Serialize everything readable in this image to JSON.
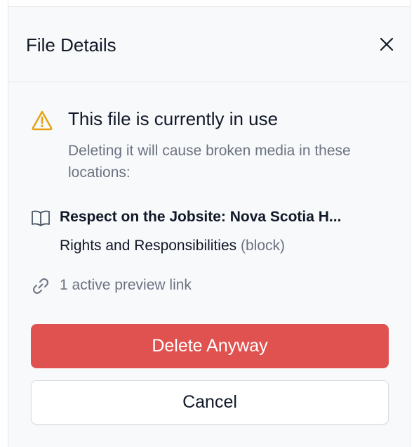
{
  "panel": {
    "title": "File Details",
    "close_icon": "close-icon"
  },
  "warning": {
    "icon": "warning-triangle-icon",
    "icon_color": "#e5a10e",
    "title": "This file is currently in use",
    "description": "Deleting it will cause broken media in these locations:"
  },
  "usages": [
    {
      "icon": "book-icon",
      "title": "Respect on the Jobsite: Nova Scotia H...",
      "subtitle": "Rights and Responsibilities",
      "tag": "(block)"
    }
  ],
  "preview_links": {
    "icon": "link-icon",
    "text": "1 active preview link"
  },
  "actions": {
    "delete_label": "Delete Anyway",
    "delete_color": "#e0524f",
    "cancel_label": "Cancel"
  }
}
